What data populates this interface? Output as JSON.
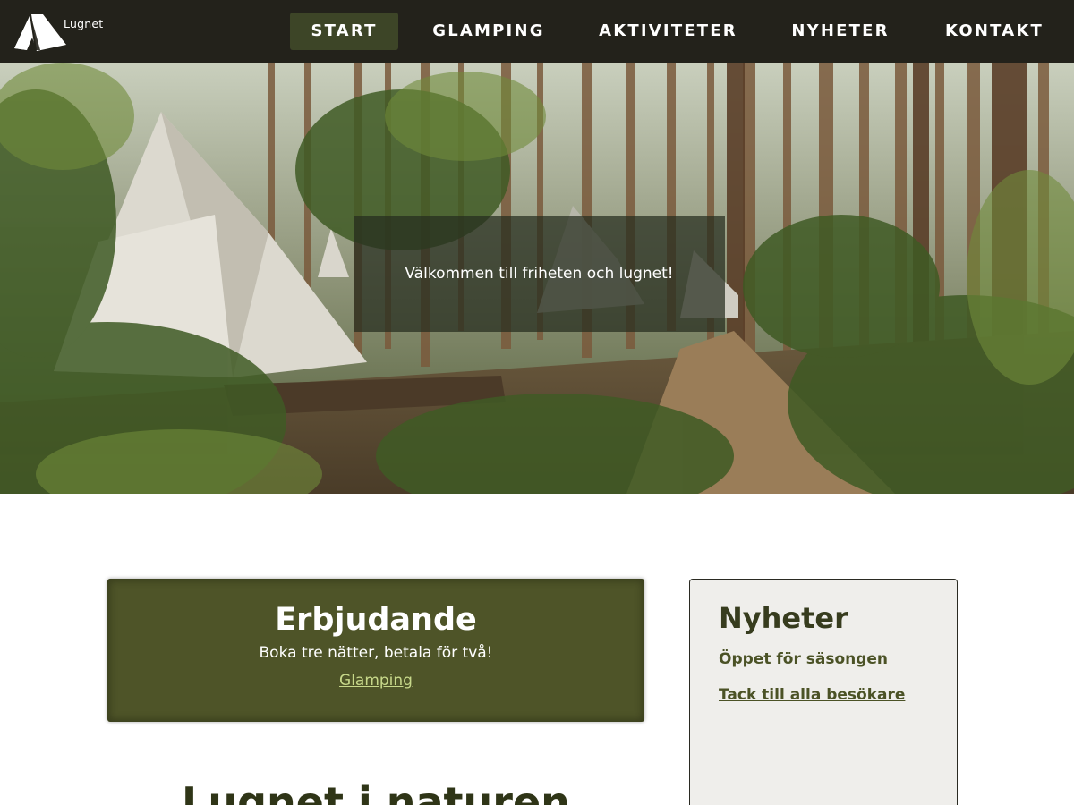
{
  "brand": {
    "name": "Lugnet",
    "logo_icon": "tent-icon"
  },
  "nav": {
    "items": [
      {
        "label": "START",
        "active": true
      },
      {
        "label": "GLAMPING",
        "active": false
      },
      {
        "label": "AKTIVITETER",
        "active": false
      },
      {
        "label": "NYHETER",
        "active": false
      },
      {
        "label": "KONTAKT",
        "active": false
      }
    ]
  },
  "hero": {
    "image": "forest-glamping-tents-photo",
    "welcome_text": "Välkommen till friheten och lugnet!"
  },
  "offer": {
    "title": "Erbjudande",
    "text": "Boka tre nätter, betala för två!",
    "link": "Glamping"
  },
  "section": {
    "title": "Lugnet i naturen"
  },
  "news": {
    "title": "Nyheter",
    "items": [
      {
        "label": "Öppet för säsongen"
      },
      {
        "label": "Tack till alla besökare"
      }
    ]
  },
  "colors": {
    "nav_bg": "#23221b",
    "nav_active": "#3d4527",
    "offer_bg": "#4e5428",
    "offer_link": "#c7d88a",
    "news_bg": "#efeeeb",
    "heading": "#373c1e"
  }
}
